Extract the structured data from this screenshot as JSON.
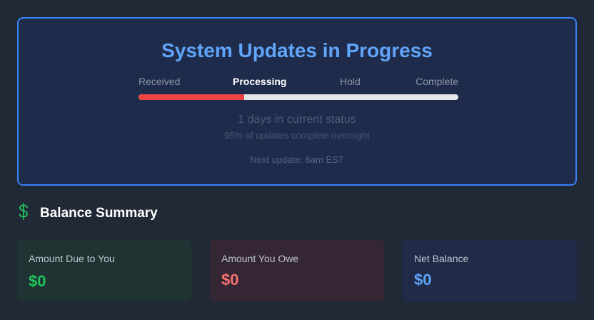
{
  "status": {
    "title": "System Updates in Progress",
    "steps": [
      "Received",
      "Processing",
      "Hold",
      "Complete"
    ],
    "active_step": 1,
    "progress_percent": 33,
    "days_text": "1 days in current status",
    "overnight_text": "95% of updates complete overnight",
    "next_update_text": "Next update: 6am EST"
  },
  "balance": {
    "icon": "dollar-icon",
    "title": "Balance Summary",
    "cards": [
      {
        "label": "Amount Due to You",
        "amount": "$0",
        "color": "#22c55e"
      },
      {
        "label": "Amount You Owe",
        "amount": "$0",
        "color": "#f87171"
      },
      {
        "label": "Net Balance",
        "amount": "$0",
        "color": "#60a5fa"
      }
    ]
  },
  "colors": {
    "accent": "#3b82f6",
    "progress": "#ef4444"
  }
}
